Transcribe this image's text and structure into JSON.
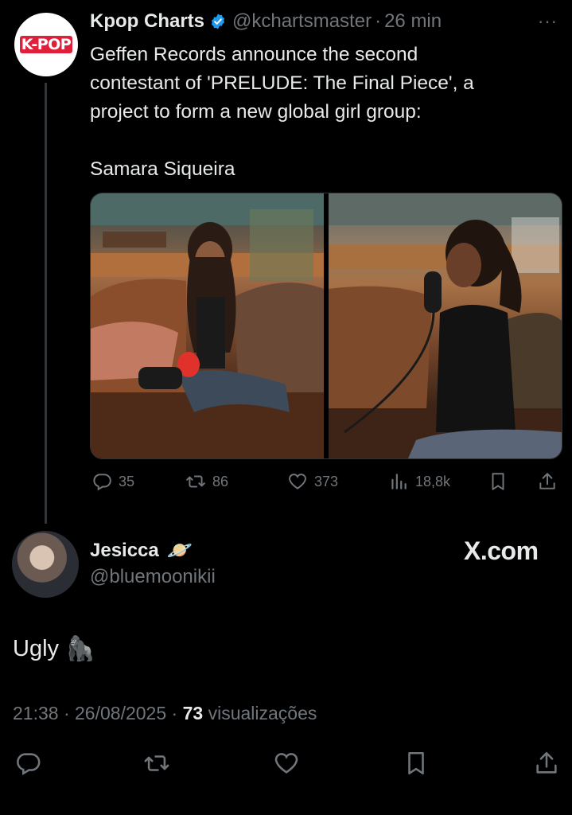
{
  "quoted": {
    "avatar_logo": "K-POP",
    "name": "Kpop Charts",
    "handle": "@kchartsmaster",
    "separator": "·",
    "time": "26 min",
    "more": "···",
    "text_lines": [
      "Geffen Records announce the second",
      "contestant of 'PRELUDE: The Final Piece', a",
      "project to form a new global girl group:"
    ],
    "text_last": "Samara Siqueira",
    "stats": {
      "replies": "35",
      "reposts": "86",
      "likes": "373",
      "views": "18,8k"
    }
  },
  "reply": {
    "name": "Jesicca",
    "name_emoji": "🪐",
    "handle": "@bluemoonikii",
    "watermark": "X.com",
    "text": "Ugly",
    "text_emoji": "🦍",
    "time": "21:38",
    "date": "26/08/2025",
    "views_count": "73",
    "views_label": "visualizações"
  },
  "icons": {
    "reply": "speech-bubble-icon",
    "repost": "repost-icon",
    "like": "heart-icon",
    "views": "bar-chart-icon",
    "bookmark": "bookmark-icon",
    "share": "share-icon"
  }
}
